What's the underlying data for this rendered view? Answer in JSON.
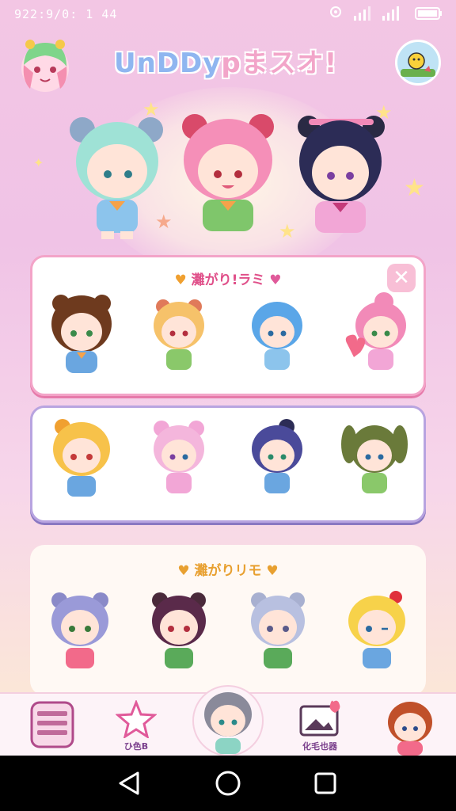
{
  "status_bar": {
    "time": "922:9/0: 1 44"
  },
  "header": {
    "title_a": "UnDDy",
    "title_b": "pまスオ!"
  },
  "panels": [
    {
      "heading": "灘がり!ラミ"
    },
    {
      "heading": ""
    },
    {
      "heading": "灘がりリモ"
    }
  ],
  "tabs": [
    {
      "label": ""
    },
    {
      "label": "ひ色B"
    },
    {
      "label": ""
    },
    {
      "label": "化毛也器"
    },
    {
      "label": ""
    }
  ],
  "icons": {
    "signal": "signal-icon",
    "settings": "gear-icon",
    "close": "close-icon",
    "back": "back-icon",
    "home": "home-icon",
    "recents": "recents-icon"
  },
  "colors": {
    "accent_pink": "#f3a4c8",
    "accent_purple": "#b8a4e0",
    "title_blue": "#8fb6f0"
  }
}
